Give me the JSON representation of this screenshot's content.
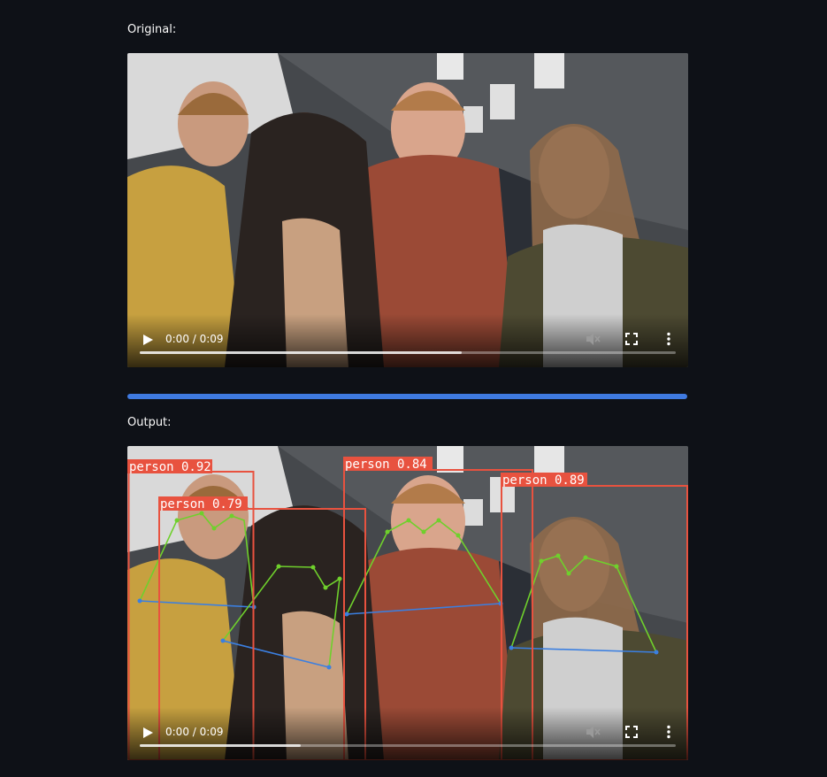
{
  "original": {
    "label": "Original:",
    "player": {
      "time": "0:00 / 0:09",
      "buffered_fraction": 0.6,
      "icons": [
        "play-icon",
        "volume-muted-icon",
        "fullscreen-icon",
        "more-options-icon"
      ]
    }
  },
  "output": {
    "label": "Output:",
    "player": {
      "time": "0:00 / 0:09",
      "buffered_fraction": 0.3,
      "icons": [
        "play-icon",
        "volume-muted-icon",
        "fullscreen-icon",
        "more-options-icon"
      ]
    },
    "detections": [
      {
        "label": "person 0.92"
      },
      {
        "label": "person 0.79"
      },
      {
        "label": "person 0.84"
      },
      {
        "label": "person 0.89"
      }
    ]
  },
  "colors": {
    "background": "#0e1117",
    "progress_bar": "#3f7ae0",
    "box": "#e8523f",
    "skeleton_green": "#6fd02c",
    "skeleton_blue": "#3b7fe0"
  }
}
